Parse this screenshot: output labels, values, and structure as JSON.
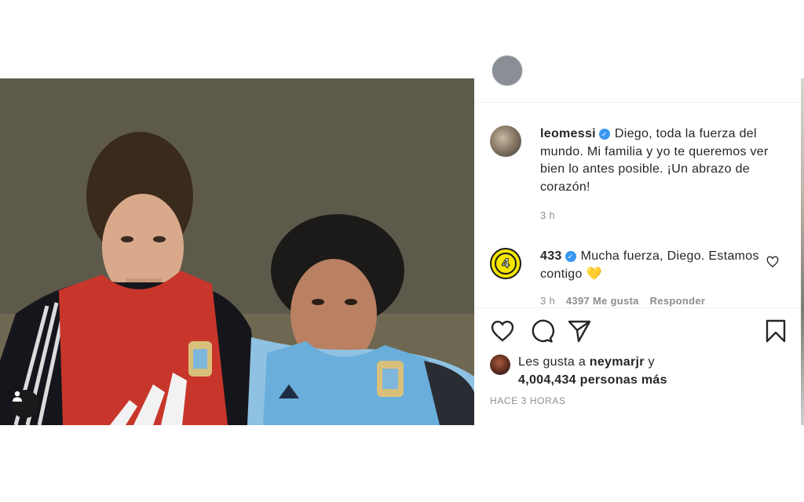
{
  "comments": [
    {
      "username": "leomessi",
      "text": "Diego, toda la fuerza del mundo. Mi familia y yo te queremos ver bien lo antes posible. ¡Un abrazo de corazón!",
      "time": "3 h"
    },
    {
      "username": "433",
      "avatar_text": "4",
      "text": "Mucha fuerza, Diego. Estamos contigo 💛",
      "time": "3 h",
      "likes": "4397 Me gusta",
      "reply": "Responder"
    }
  ],
  "likes": {
    "prefix": "Les gusta a",
    "user": "neymarjr",
    "connector": "y",
    "count": "4,004,434 personas más"
  },
  "timestamp": "HACE 3 HORAS",
  "colors": {
    "verified": "#3897f0",
    "muted_text": "#8e8e8e",
    "text": "#262626",
    "bib_red": "#c8362b",
    "bib_blue": "#6aaedb"
  },
  "icons": {
    "like": "heart-icon",
    "comment": "speech-bubble-icon",
    "share": "paper-plane-icon",
    "save": "bookmark-icon",
    "tag": "person-icon",
    "verified": "verified-badge-icon"
  }
}
